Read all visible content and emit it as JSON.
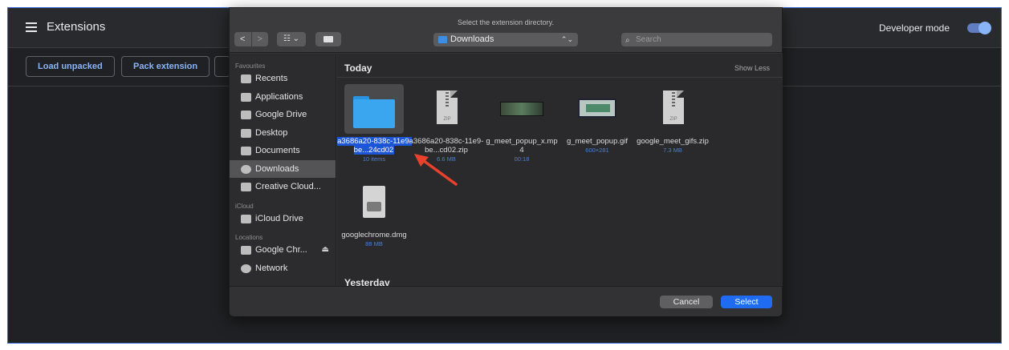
{
  "chrome_page": {
    "title": "Extensions",
    "developer_mode_label": "Developer mode",
    "developer_mode_on": true,
    "buttons": [
      "Load unpacked",
      "Pack extension"
    ]
  },
  "dialog": {
    "title": "Select the extension directory.",
    "nav": {
      "back": "<",
      "forward": ">"
    },
    "view_glyph": "☷ ⌄",
    "location": "Downloads",
    "location_chevron": "⌃⌄",
    "search_placeholder": "Search",
    "sidebar": {
      "sections": [
        {
          "heading": "Favourites",
          "items": [
            {
              "label": "Recents",
              "icon": "recents-icon",
              "selected": false
            },
            {
              "label": "Applications",
              "icon": "applications-icon",
              "selected": false
            },
            {
              "label": "Google Drive",
              "icon": "folder-icon",
              "selected": false
            },
            {
              "label": "Desktop",
              "icon": "desktop-icon",
              "selected": false
            },
            {
              "label": "Documents",
              "icon": "documents-icon",
              "selected": false
            },
            {
              "label": "Downloads",
              "icon": "downloads-icon",
              "selected": true
            },
            {
              "label": "Creative Cloud...",
              "icon": "folder-icon",
              "selected": false
            }
          ]
        },
        {
          "heading": "iCloud",
          "items": [
            {
              "label": "iCloud Drive",
              "icon": "cloud-icon",
              "selected": false
            }
          ]
        },
        {
          "heading": "Locations",
          "items": [
            {
              "label": "Google Chr...",
              "icon": "disk-icon",
              "selected": false,
              "eject": "⏏"
            },
            {
              "label": "Network",
              "icon": "network-icon",
              "selected": false
            }
          ]
        }
      ]
    },
    "section_today": "Today",
    "show_less": "Show Less",
    "files": [
      {
        "name": "a3686a20-838c-11e9-be...24cd02",
        "meta": "10 items",
        "kind": "folder",
        "selected": true
      },
      {
        "name": "a3686a20-838c-11e9-be...cd02.zip",
        "meta": "6.6 MB",
        "kind": "zip",
        "selected": false
      },
      {
        "name": "g_meet_popup_x.mp4",
        "meta": "00:18",
        "kind": "video",
        "selected": false
      },
      {
        "name": "g_meet_popup.gif",
        "meta": "600×281",
        "kind": "gif",
        "selected": false
      },
      {
        "name": "google_meet_gifs.zip",
        "meta": "7.3 MB",
        "kind": "zip",
        "selected": false
      },
      {
        "name": "googlechrome.dmg",
        "meta": "88 MB",
        "kind": "dmg",
        "selected": false
      }
    ],
    "section_yesterday": "Yesterday",
    "cancel_label": "Cancel",
    "select_label": "Select"
  },
  "colors": {
    "accent": "#1f6cf3",
    "annotation_arrow": "#e8412c",
    "selection": "#1c55d6"
  }
}
